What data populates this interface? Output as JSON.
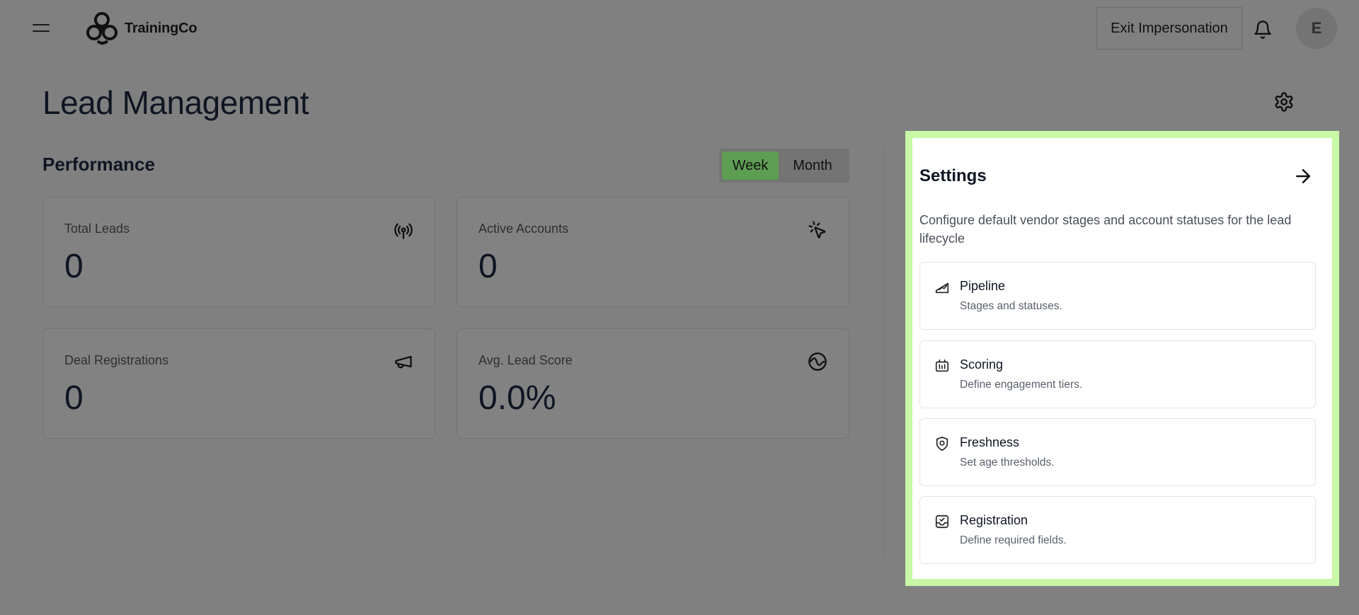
{
  "app": {
    "logo_text": "TrainingCo",
    "exit_impersonation_label": "Exit Impersonation",
    "avatar_initial": "E",
    "icons": {
      "menu": "hamburger-icon",
      "notifications": "bell-icon",
      "settings": "gear-icon"
    }
  },
  "page": {
    "title": "Lead Management"
  },
  "performance": {
    "title": "Performance",
    "period_options": [
      "Week",
      "Month"
    ],
    "selected_period": "Week",
    "cards": [
      {
        "label": "Total Leads",
        "value": "0",
        "icon": "broadcast-icon"
      },
      {
        "label": "Active Accounts",
        "value": "0",
        "icon": "click-cursor-icon"
      },
      {
        "label": "Deal Registrations",
        "value": "0",
        "icon": "megaphone-icon"
      },
      {
        "label": "Avg. Lead Score",
        "value": "0.0%",
        "icon": "gauge-wave-icon"
      }
    ]
  },
  "settings_panel": {
    "title": "Settings",
    "description": "Configure default vendor stages and account statuses for the lead lifecycle",
    "accent_color": "#c8f7a5",
    "items": [
      {
        "title": "Pipeline",
        "subtitle": "Stages and statuses.",
        "icon": "pipeline-chart-icon"
      },
      {
        "title": "Scoring",
        "subtitle": "Define engagement tiers.",
        "icon": "scoring-icon"
      },
      {
        "title": "Freshness",
        "subtitle": "Set age thresholds.",
        "icon": "shield-icon"
      },
      {
        "title": "Registration",
        "subtitle": "Define required fields.",
        "icon": "inbox-check-icon"
      }
    ]
  },
  "colors": {
    "overlay_background": "#808080",
    "active_toggle": "#5e9e53"
  }
}
